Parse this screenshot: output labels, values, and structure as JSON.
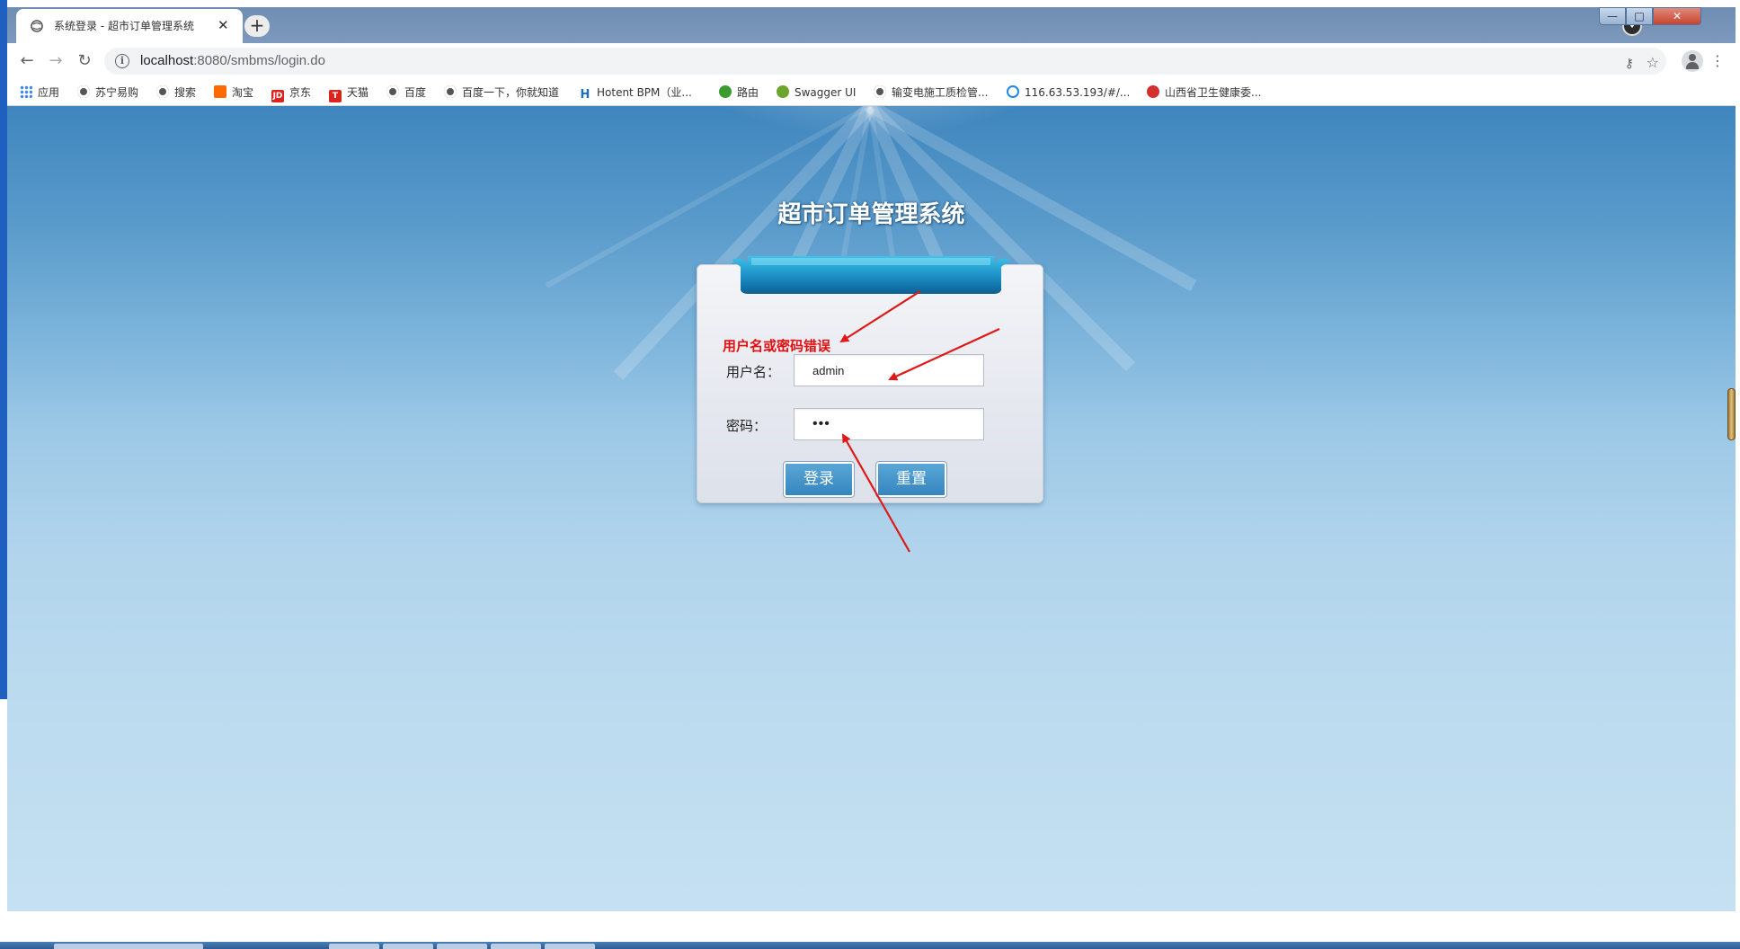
{
  "browser": {
    "tab_title": "系统登录 - 超市订单管理系统",
    "tab_close": "✕",
    "new_tab": "+",
    "url_host": "localhost",
    "url_rest": ":8080/smbms/login.do",
    "window_buttons": {
      "minimize": "—",
      "maximize": "□",
      "close": "✕"
    }
  },
  "toolbar": {
    "back": "←",
    "forward": "→",
    "reload": "↻",
    "info": "i",
    "key": "⚷",
    "star": "☆",
    "menu": "⋮"
  },
  "bookmarks": [
    {
      "label": "应用",
      "icon": "apps-icon"
    },
    {
      "label": "苏宁易购",
      "icon": "globe-icon"
    },
    {
      "label": "搜索",
      "icon": "globe-icon"
    },
    {
      "label": "淘宝",
      "icon": "taobao-icon"
    },
    {
      "label": "京东",
      "icon": "jd-icon",
      "mark": "JD"
    },
    {
      "label": "天猫",
      "icon": "tmall-icon",
      "mark": "T"
    },
    {
      "label": "百度",
      "icon": "globe-icon"
    },
    {
      "label": "百度一下，你就知道",
      "icon": "globe-icon"
    },
    {
      "label": "Hotent BPM（业...",
      "icon": "hotent-icon",
      "mark": "H"
    },
    {
      "label": "路由",
      "icon": "route-icon"
    },
    {
      "label": "Swagger UI",
      "icon": "swagger-icon"
    },
    {
      "label": "输变电施工质检管...",
      "icon": "globe-icon"
    },
    {
      "label": "116.63.53.193/#/...",
      "icon": "ie-icon"
    },
    {
      "label": "山西省卫生健康委...",
      "icon": "gov-icon"
    }
  ],
  "login": {
    "system_title": "超市订单管理系统",
    "error_message": "用户名或密码错误",
    "username_label": "用户名：",
    "username_value": "admin",
    "password_label": "密码：",
    "password_value": "•••",
    "login_button": "登录",
    "reset_button": "重置"
  },
  "colors": {
    "error": "#e01010",
    "arrow": "#e01818",
    "button": "#3585bf",
    "page_top": "#3f86be",
    "page_bottom": "#c5e0f2"
  }
}
